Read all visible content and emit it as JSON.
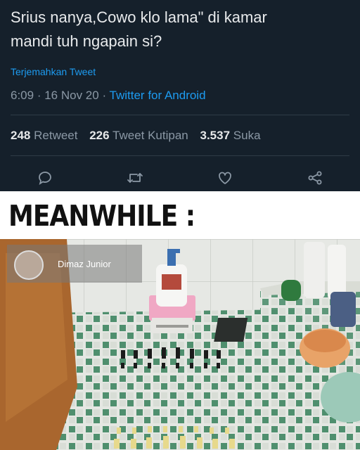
{
  "tweet": {
    "text_line1": "Srius nanya,Cowo klo lama\" di kamar",
    "text_line2": "mandi tuh ngapain si?",
    "translate_link": "Terjemahkan Tweet",
    "time": "6:09",
    "date": "16 Nov 20",
    "source": "Twitter for Android",
    "retweet_count": "248",
    "retweet_label": "Retweet",
    "quote_count": "226",
    "quote_label": "Tweet Kutipan",
    "like_count": "3.537",
    "like_label": "Suka",
    "actions": [
      "reply-icon",
      "retweet-icon",
      "like-icon",
      "share-icon"
    ],
    "colors": {
      "background": "#15202b",
      "link": "#1d9bf0",
      "muted": "#8b98a5",
      "text": "#e7e9ea"
    }
  },
  "caption": {
    "text": "MEANWHILE :"
  },
  "photo": {
    "user_label": "Dimaz Junior"
  }
}
